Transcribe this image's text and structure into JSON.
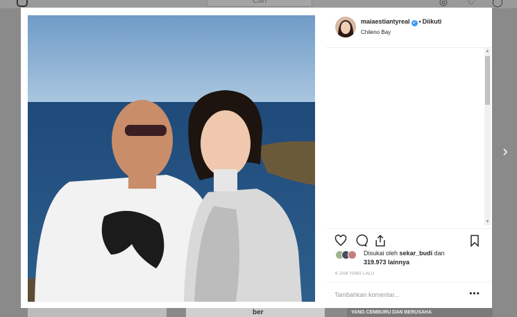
{
  "background": {
    "search_placeholder": "Cari",
    "thumbs": [
      "",
      "ber",
      "YANG CEMBURU DAN BERUSAHA"
    ]
  },
  "post": {
    "username": "maiaestiantyreal",
    "separator": "•",
    "follow_status": "Diikuti",
    "location": "Chileno Bay",
    "liked_by_prefix": "Disukai oleh",
    "liked_by_user": "sekar_budi",
    "liked_by_and": "dan",
    "liked_by_others": "319.973 lainnya",
    "time_ago": "6 JAM YANG LALU",
    "comment_placeholder": "Tambahkan komentar...",
    "more_label": "•••"
  },
  "icons": {
    "like": "heart-icon",
    "comment": "comment-icon",
    "share": "share-icon",
    "save": "bookmark-icon",
    "verified": "verified-badge-icon",
    "next": "chevron-right-icon"
  },
  "colors": {
    "verified": "#3897f0",
    "text": "#262626",
    "muted": "#999999"
  }
}
